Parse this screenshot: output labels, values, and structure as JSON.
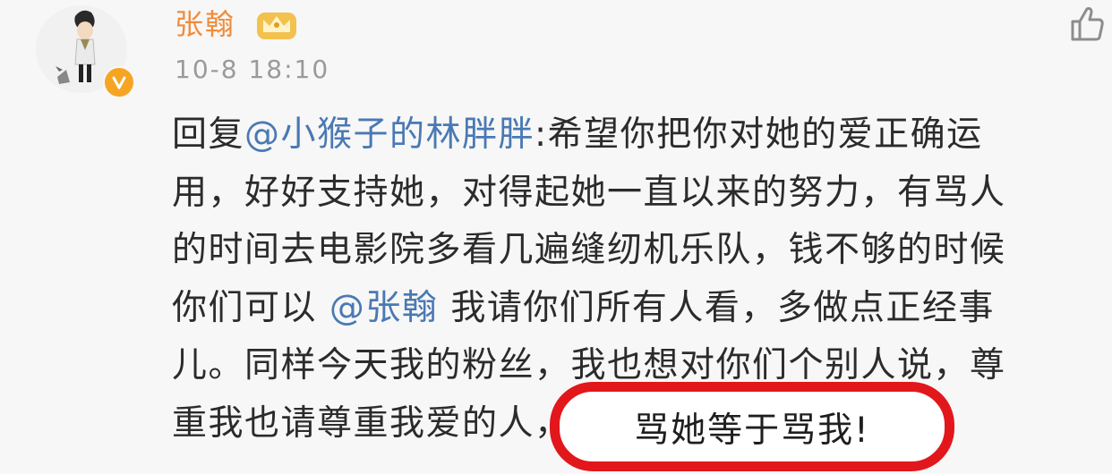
{
  "post": {
    "author": "张翰",
    "timestamp": "10-8 18:10",
    "content_lines": [
      {
        "before": "回复",
        "mention": "@小猴子的林胖胖",
        "after": ":希望你把你对她的爱正确运"
      },
      {
        "before": "用，好好支持她，对得起她一直以来的努力，有骂人",
        "mention": "",
        "after": ""
      },
      {
        "before": "的时间去电影院多看几遍缝纫机乐队，钱不够的时候",
        "mention": "",
        "after": ""
      },
      {
        "before": "你们可以 ",
        "mention": "@张翰",
        "after": " 我请你们所有人看，多做点正经事"
      },
      {
        "before": "儿。同样今天我的粉丝，我也想对你们个别人说，尊",
        "mention": "",
        "after": ""
      },
      {
        "before": "重我也请尊重我爱的人，",
        "mention": "",
        "after": ""
      }
    ],
    "highlight_text": "骂她等于骂我!"
  },
  "icons": {
    "avatar": "avatar-image",
    "verified": "verified-badge-icon",
    "crown": "crown-icon",
    "like": "thumbs-up-icon"
  },
  "colors": {
    "username": "#f08c3c",
    "mention": "#4a79b3",
    "highlight_border": "#e2171c",
    "verified_badge": "#f6a523"
  }
}
